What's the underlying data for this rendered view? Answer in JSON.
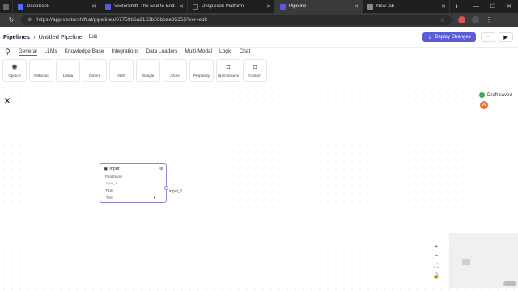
{
  "browser": {
    "tabs": [
      {
        "title": "DeepSeek",
        "active": false,
        "favicon_color": "#4d6bfe"
      },
      {
        "title": "VectorShift: The End-to-End AI Au",
        "active": false,
        "favicon_color": "#5b5bd6"
      },
      {
        "title": "DeepSeek Platform",
        "active": false,
        "favicon_color": "#222222"
      },
      {
        "title": "Pipeline",
        "active": true,
        "favicon_color": "#5b5bd6"
      },
      {
        "title": "New tab",
        "active": false,
        "favicon_color": "#888888"
      }
    ],
    "url": "https://app.vectorshift.ai/pipelines/67759b6a2153b56bbae35355?vw=edit"
  },
  "header": {
    "breadcrumb": "Pipelines",
    "pipeline_name": "Untitled Pipeline",
    "edit_label": "Edit",
    "deploy_label": "Deploy Changes"
  },
  "node_tabs": [
    "General",
    "LLMs",
    "Knowledge Base",
    "Integrations",
    "Data Loaders",
    "Multi-Modal",
    "Logic",
    "Chat"
  ],
  "llm_cards": [
    {
      "label": "OpenAI",
      "icon": "openai-icon"
    },
    {
      "label": "Anthropic",
      "icon": "anthropic-icon"
    },
    {
      "label": "Llama",
      "icon": "llama-icon"
    },
    {
      "label": "Cohere",
      "icon": "cohere-icon"
    },
    {
      "label": "AWS",
      "icon": "aws-icon"
    },
    {
      "label": "Google",
      "icon": "google-icon"
    },
    {
      "label": "Azure",
      "icon": "azure-icon"
    },
    {
      "label": "Perplexity",
      "icon": "perplexity-icon"
    },
    {
      "label": "Open Source",
      "icon": "crop-icon"
    },
    {
      "label": "Custom",
      "icon": "crop-icon"
    }
  ],
  "status": {
    "draft_text": "Draft saved",
    "avatar_initial": "A"
  },
  "node": {
    "title": "Input",
    "field_name_label": "Field Name",
    "field_name_value": "input_1",
    "type_label": "Type",
    "type_value": "Text",
    "output_handle": "input_1"
  },
  "colors": {
    "accent": "#5b5bd6",
    "saved": "#2ea44f",
    "avatar": "#e8743b"
  }
}
